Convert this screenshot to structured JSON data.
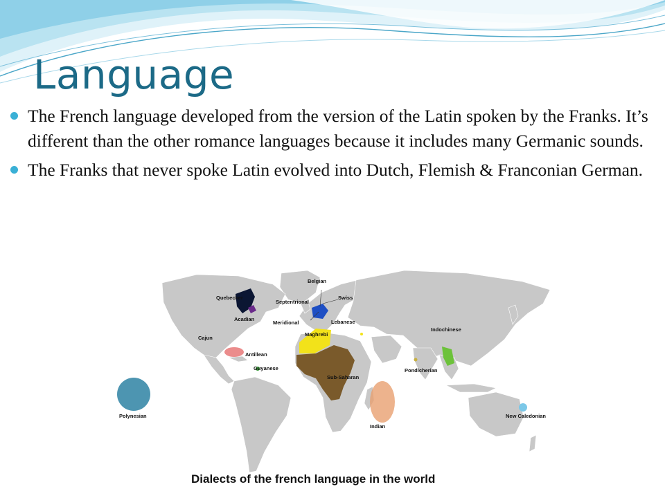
{
  "slide": {
    "title": "Language",
    "bullets": [
      "The French language developed from the version of the Latin spoken by the Franks. It’s different than the other romance languages because it includes many Germanic sounds.",
      "The Franks that never spoke Latin evolved into Dutch, Flemish & Franconian German."
    ]
  },
  "map": {
    "caption": "Dialects of the french language in the world",
    "labels": {
      "belgian": "Belgian",
      "quebecker": "Quebecker",
      "septentrional": "Septentrional",
      "swiss": "Swiss",
      "acadian": "Acadian",
      "meridional": "Meridional",
      "lebanese": "Lebanese",
      "maghrebi": "Maghrebi",
      "cajun": "Cajun",
      "indochinese": "Indochinese",
      "antillean": "Antillean",
      "guyanese": "Guyanese",
      "pondicherian": "Pondicherian",
      "sub_saharan": "Sub-Saharan",
      "polynesian": "Polynesian",
      "indian": "Indian",
      "new_caledonian": "New Caledonian"
    },
    "colors": {
      "land": "#c8c8c8",
      "quebec": "#0b1633",
      "france": "#1e4fc4",
      "maghreb": "#f2e21a",
      "sub_saharan": "#7a5a2b",
      "caribbean": "#e87878",
      "polynesia": "#3a8aa8",
      "indian_ocean": "#e8a070",
      "new_caledonia": "#7cc8e8",
      "indochina": "#6cc23a"
    }
  }
}
